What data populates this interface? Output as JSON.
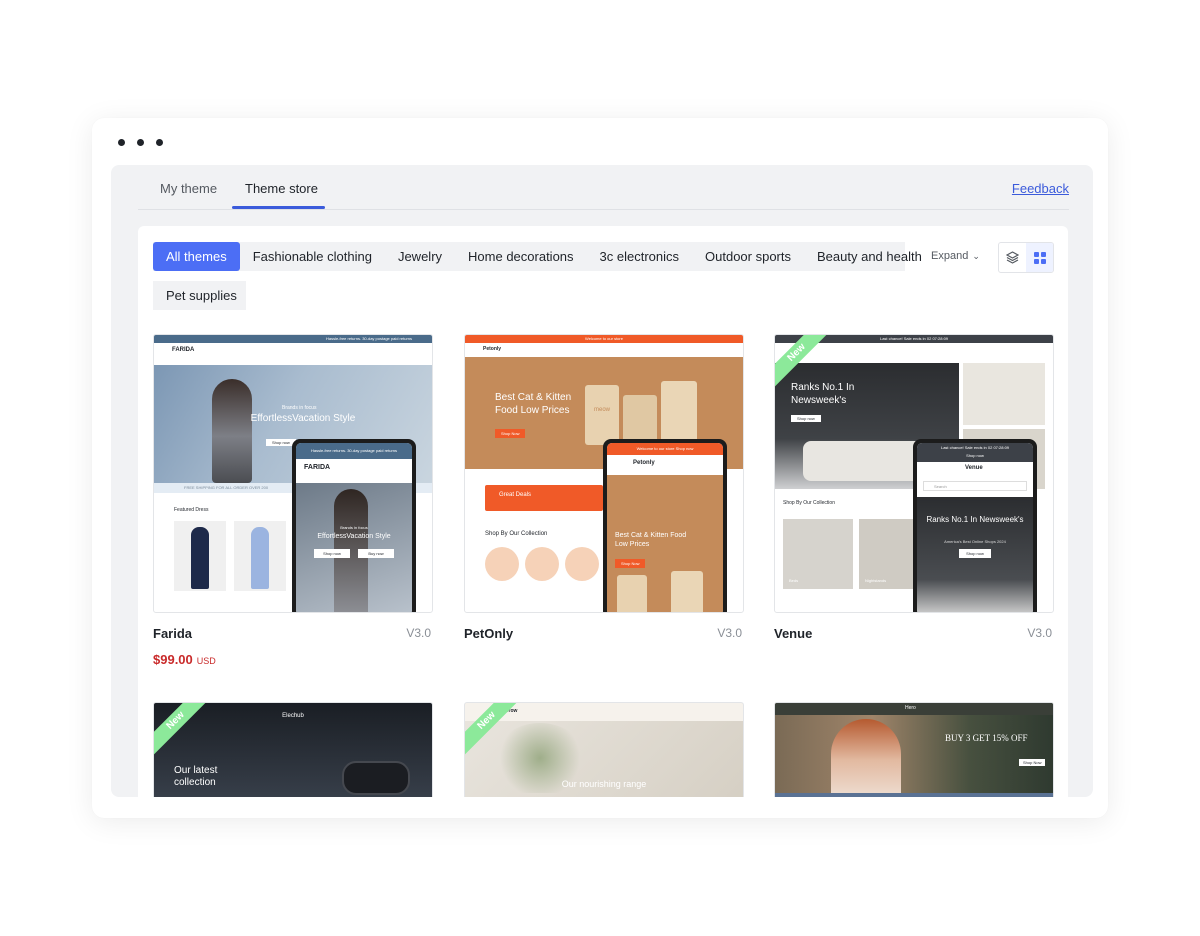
{
  "tabs": {
    "my_theme": "My theme",
    "theme_store": "Theme store",
    "feedback": "Feedback"
  },
  "filters": {
    "chips": [
      "All themes",
      "Fashionable clothing",
      "Jewelry",
      "Home decorations",
      "3c electronics",
      "Outdoor sports",
      "Beauty and health"
    ],
    "chips_row2": [
      "Pet supplies"
    ],
    "active": "All themes",
    "expand_label": "Expand"
  },
  "themes": [
    {
      "name": "Farida",
      "version": "V3.0",
      "price": "$99.00",
      "currency": "USD",
      "badge": "",
      "preview": {
        "promo": "Hassle-free returns. 30-day postage paid returns",
        "logo": "FARIDA",
        "hero_kicker": "Brands in focus",
        "hero_title": "EffortlessVacation Style",
        "hero_btn": "Shop now",
        "section": "Featured Dress",
        "mobile_logo": "FARIDA",
        "mobile_kicker": "Brands in focus",
        "mobile_title": "EffortlessVacation Style",
        "mobile_btn1": "Shop now",
        "mobile_btn2": "Buy now",
        "shipping": "FREE SHIPPING FOR ALL ORDER OVER 200"
      }
    },
    {
      "name": "PetOnly",
      "version": "V3.0",
      "price": "",
      "currency": "",
      "badge": "",
      "preview": {
        "promo": "Welcome to our store",
        "logo": "Petonly",
        "hero_title": "Best Cat & Kitten Food Low Prices",
        "hero_btn": "Shop Now",
        "deals": "Great Deals",
        "section": "Shop By Our Collection",
        "mobile_promo": "Welcome to our store Shop now",
        "mobile_logo": "Petonly",
        "mobile_title": "Best Cat & Kitten Food Low Prices",
        "mobile_btn": "Shop Now",
        "bag_label": "meow"
      }
    },
    {
      "name": "Venue",
      "version": "V3.0",
      "price": "",
      "currency": "",
      "badge": "New",
      "preview": {
        "promo": "Last chance! Sale ends in 02 07:28:09",
        "hero_title": "Ranks No.1 In Newsweek's",
        "hero_btn": "Shop now",
        "section": "Shop By Our Collection",
        "cat1": "Beds",
        "cat2": "Nightstands",
        "mobile_promo": "Last chance! Sale ends in 02 07:28:09",
        "mobile_shop": "Shop now",
        "mobile_logo": "Venue",
        "mobile_search": "Search",
        "mobile_title": "Ranks No.1 In Newsweek's",
        "mobile_sub": "America's Best Online Shops 2024",
        "mobile_btn": "Shop now"
      }
    },
    {
      "name": "",
      "version": "",
      "price": "",
      "currency": "",
      "badge": "New",
      "preview": {
        "logo": "Elechub",
        "hero_title": "Our latest collection"
      }
    },
    {
      "name": "",
      "version": "",
      "price": "",
      "currency": "",
      "badge": "New",
      "preview": {
        "logo": "Arrow",
        "hero_title": "Our nourishing range"
      }
    },
    {
      "name": "",
      "version": "",
      "price": "",
      "currency": "",
      "badge": "",
      "preview": {
        "logo": "Hero",
        "hero_title": "BUY 3 GET 15% OFF",
        "hero_btn": "Shop Now"
      }
    }
  ]
}
